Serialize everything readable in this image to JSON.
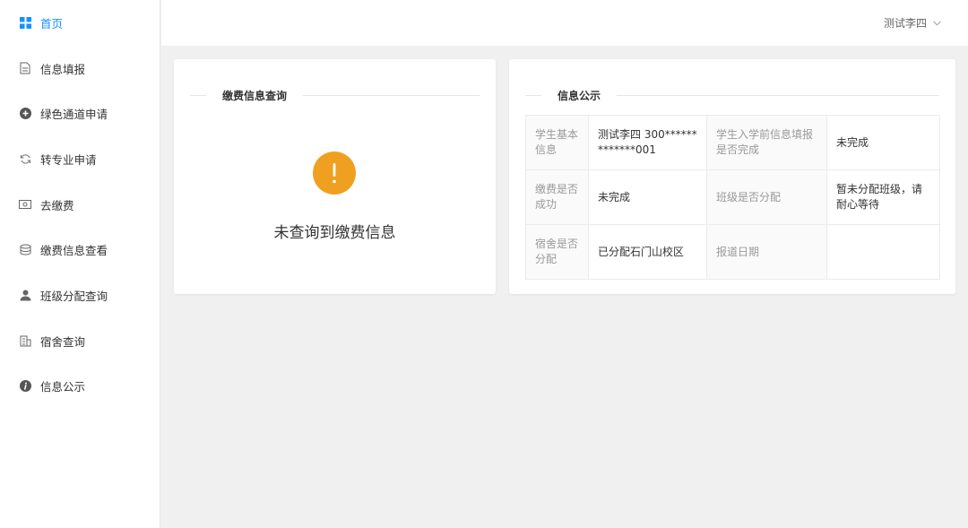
{
  "theme": {
    "accent": "#1890ff",
    "warning": "#f0a020"
  },
  "sidebar": {
    "items": [
      {
        "label": "首页",
        "icon": "grid-icon",
        "active": true
      },
      {
        "label": "信息填报",
        "icon": "document-icon"
      },
      {
        "label": "绿色通道申请",
        "icon": "circle-plus-icon"
      },
      {
        "label": "转专业申请",
        "icon": "refresh-icon"
      },
      {
        "label": "去缴费",
        "icon": "banknote-icon"
      },
      {
        "label": "缴费信息查看",
        "icon": "database-icon"
      },
      {
        "label": "班级分配查询",
        "icon": "user-icon"
      },
      {
        "label": "宿舍查询",
        "icon": "building-icon"
      },
      {
        "label": "信息公示",
        "icon": "info-icon"
      }
    ]
  },
  "header": {
    "username": "测试李四"
  },
  "payment_card": {
    "title": "缴费信息查询",
    "empty_message": "未查询到缴费信息"
  },
  "notice_card": {
    "title": "信息公示",
    "rows": [
      [
        "学生基本信息",
        "测试李四 300*************001",
        "学生入学前信息填报是否完成",
        "未完成"
      ],
      [
        "缴费是否成功",
        "未完成",
        "班级是否分配",
        "暂未分配班级，请耐心等待"
      ],
      [
        "宿舍是否分配",
        "已分配石门山校区",
        "报道日期",
        ""
      ]
    ]
  }
}
